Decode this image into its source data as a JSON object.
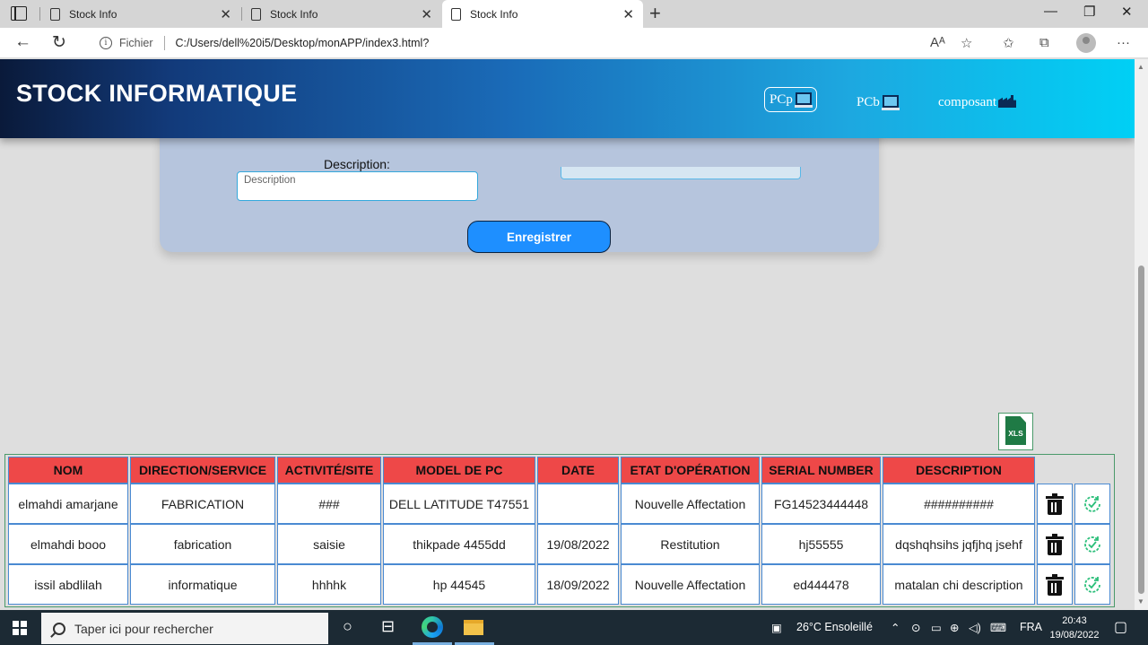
{
  "browser": {
    "tabs": [
      {
        "title": "Stock Info",
        "active": false
      },
      {
        "title": "Stock Info",
        "active": false
      },
      {
        "title": "Stock Info",
        "active": true
      }
    ],
    "address": {
      "scheme_label": "Fichier",
      "url": "C:/Users/dell%20i5/Desktop/monAPP/index3.html?"
    }
  },
  "app": {
    "brand": "STOCK INFORMATIQUE",
    "nav": [
      {
        "label": "PCp",
        "icon": "laptop-icon",
        "active": true
      },
      {
        "label": "PCb",
        "icon": "desktop-pc-icon",
        "active": false
      },
      {
        "label": "composant",
        "icon": "factory-icon",
        "active": false
      }
    ]
  },
  "form": {
    "description_label": "Description:",
    "description_placeholder": "Description",
    "submit_label": "Enregistrer"
  },
  "export": {
    "label": "XLS",
    "icon": "xls-file-icon"
  },
  "table": {
    "headers": [
      "NOM",
      "DIRECTION/SERVICE",
      "ACTIVITÉ/SITE",
      "MODEL DE PC",
      "DATE",
      "ETAT D'OPÉRATION",
      "SERIAL NUMBER",
      "DESCRIPTION"
    ],
    "rows": [
      [
        "elmahdi amarjane",
        "FABRICATION",
        "###",
        "DELL LATITUDE T47551",
        "",
        "Nouvelle Affectation",
        "FG14523444448",
        "##########"
      ],
      [
        "elmahdi booo",
        "fabrication",
        "saisie",
        "thikpade 4455dd",
        "19/08/2022",
        "Restitution",
        "hj55555",
        "dqshqhsihs jqfjhq jsehf"
      ],
      [
        "issil abdlilah",
        "informatique",
        "hhhhk",
        "hp 44545",
        "18/09/2022",
        "Nouvelle Affectation",
        "ed444478",
        "matalan chi description"
      ]
    ],
    "row_actions": [
      "trash-icon",
      "renew-icon"
    ]
  },
  "taskbar": {
    "search_placeholder": "Taper ici pour rechercher",
    "weather": "26°C  Ensoleillé",
    "language": "FRA",
    "time": "20:43",
    "date": "19/08/2022"
  }
}
